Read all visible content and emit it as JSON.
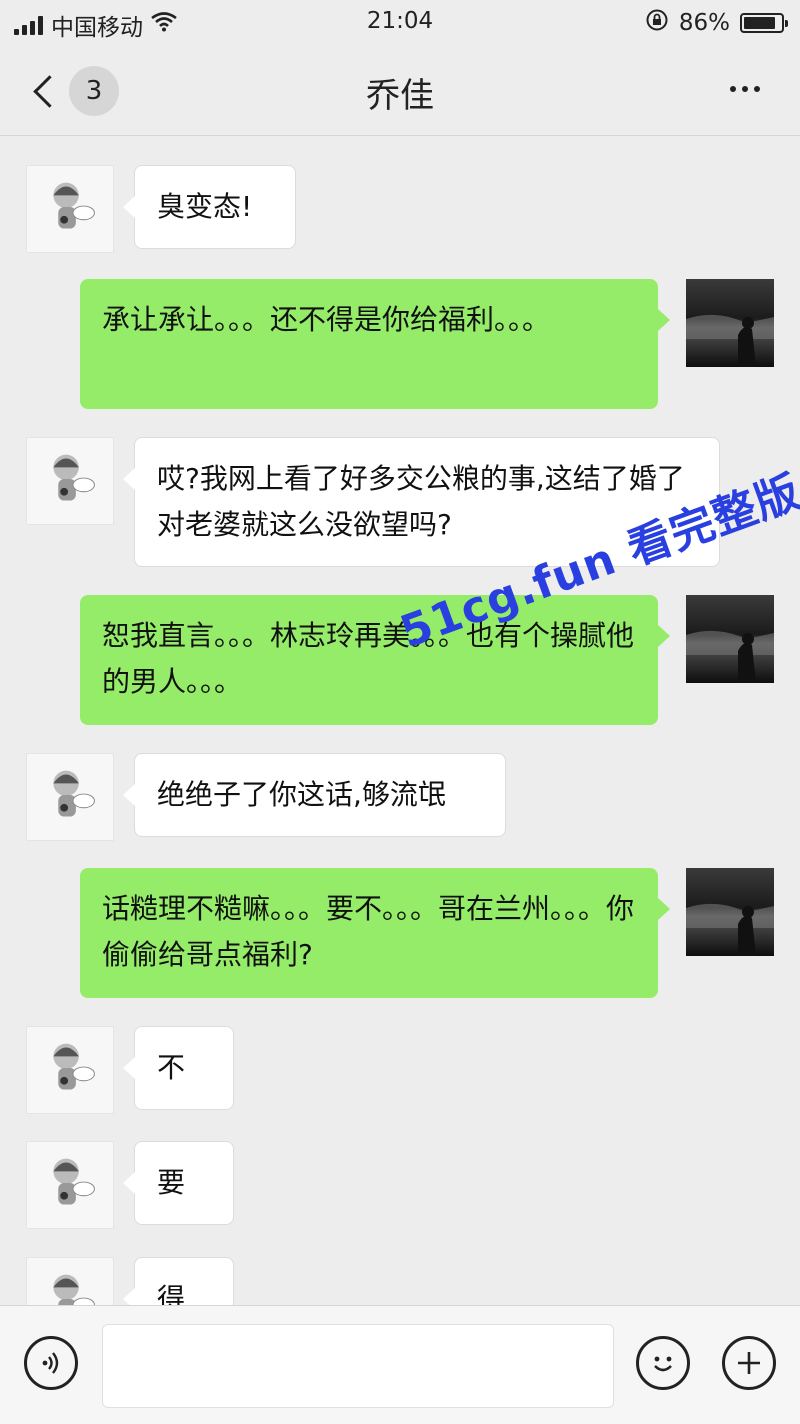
{
  "status_bar": {
    "carrier": "中国移动",
    "time": "21:04",
    "battery_percent": "86%",
    "battery_level": 0.86
  },
  "header": {
    "back_badge": "3",
    "title": "乔佳",
    "more_icon": "more-dots-icon"
  },
  "messages": [
    {
      "side": "left",
      "text": "臭变态!"
    },
    {
      "side": "right",
      "text": "承让承让。。。还不得是你给福利。。。"
    },
    {
      "side": "left",
      "text": "哎?我网上看了好多交公粮的事,这结了婚了对老婆就这么没欲望吗?"
    },
    {
      "side": "right",
      "text": "恕我直言。。。林志玲再美。。。也有个操腻他的男人。。。"
    },
    {
      "side": "left",
      "text": "绝绝子了你这话,够流氓"
    },
    {
      "side": "right",
      "text": "话糙理不糙嘛。。。要不。。。哥在兰州。。。你偷偷给哥点福利?"
    },
    {
      "side": "left",
      "text": "不"
    },
    {
      "side": "left",
      "text": "要"
    },
    {
      "side": "left",
      "text": "得"
    }
  ],
  "watermark": "51cg.fun 看完整版",
  "input_bar": {
    "text_value": "",
    "icons": [
      "voice-icon",
      "emoji-icon",
      "plus-icon"
    ]
  },
  "colors": {
    "background": "#ededed",
    "bubble_sent": "#95ec69",
    "bubble_received": "#ffffff",
    "watermark": "#2a3fe0"
  }
}
